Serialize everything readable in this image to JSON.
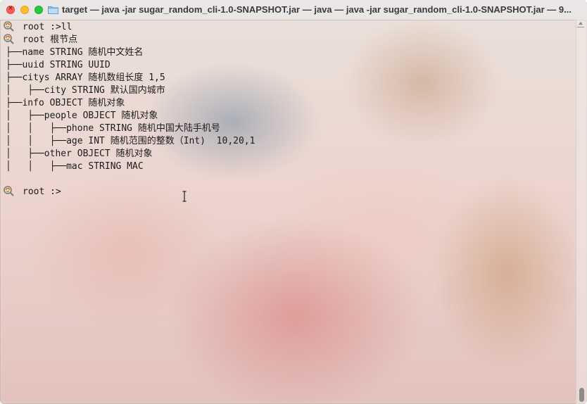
{
  "window": {
    "title": "target — java -jar sugar_random_cli-1.0-SNAPSHOT.jar — java — java -jar sugar_random_cli-1.0-SNAPSHOT.jar — 9...",
    "close_glyph": "×"
  },
  "terminal": {
    "lines": [
      "root :>ll",
      "root 根节点",
      "├──name STRING 随机中文姓名",
      "├──uuid STRING UUID",
      "├──citys ARRAY 随机数组长度 1,5",
      "│   ├──city STRING 默认国内城市",
      "├──info OBJECT 随机对象",
      "│   ├──people OBJECT 随机对象",
      "│   │   ├──phone STRING 随机中国大陆手机号",
      "│   │   ├──age INT 随机范围的整数（Int)  10,20,1",
      "│   ├──other OBJECT 随机对象",
      "│   │   ├──mac STRING MAC",
      "",
      "root :>"
    ],
    "prompt_icon": "magnifier-lollipop-icon"
  },
  "colors": {
    "text": "#1c1c1c",
    "titlebar": "#e9e6e5",
    "close": "#ff5f57",
    "minimize": "#febc2e",
    "zoom": "#28c840"
  }
}
